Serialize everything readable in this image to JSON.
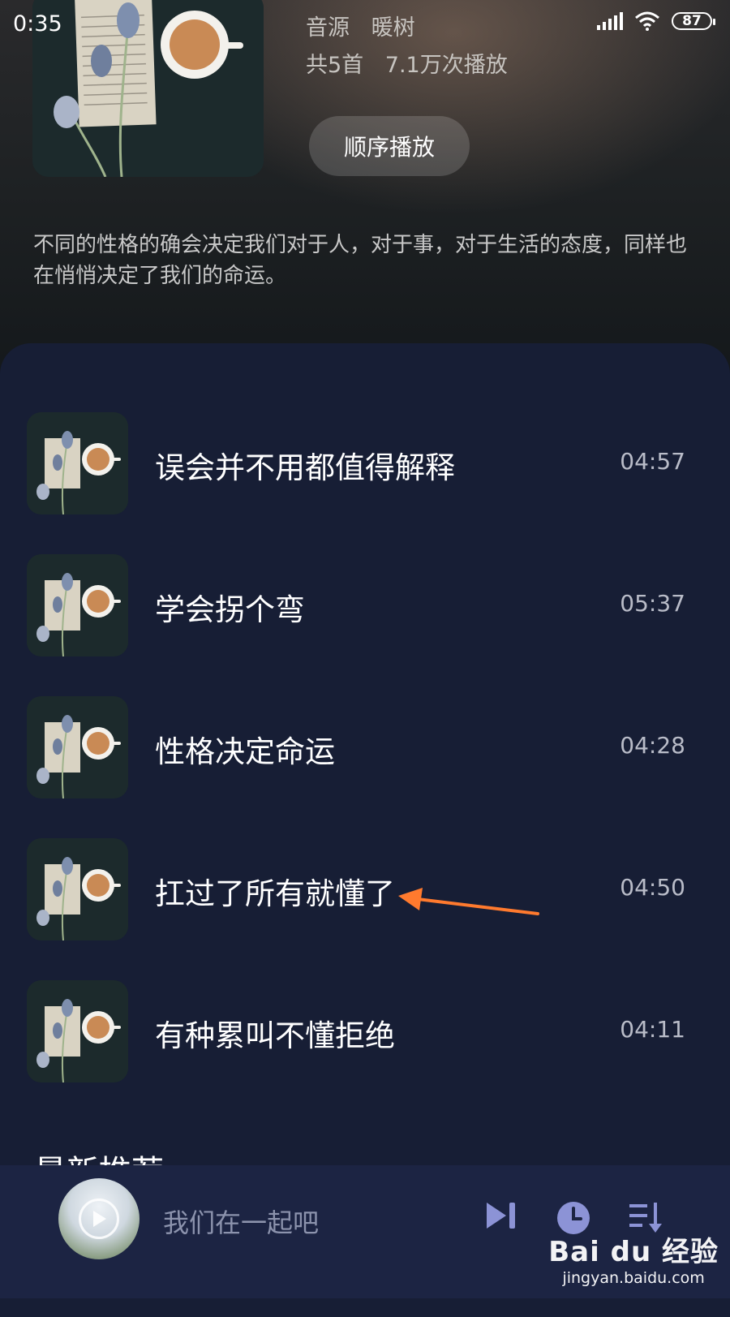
{
  "status_bar": {
    "time": "0:35",
    "battery": "87"
  },
  "album": {
    "source_label": "音源",
    "source_name": "暖树",
    "track_count": "共5首",
    "play_count": "7.1万次播放",
    "play_order_label": "顺序播放",
    "description": "不同的性格的确会决定我们对于人，对于事，对于生活的态度，同样也在悄悄决定了我们的命运。"
  },
  "tracks": [
    {
      "title": "误会并不用都值得解释",
      "duration": "04:57"
    },
    {
      "title": "学会拐个弯",
      "duration": "05:37"
    },
    {
      "title": "性格决定命运",
      "duration": "04:28"
    },
    {
      "title": "扛过了所有就懂了",
      "duration": "04:50"
    },
    {
      "title": "有种累叫不懂拒绝",
      "duration": "04:11"
    }
  ],
  "section": {
    "heading": "最新推荐"
  },
  "mini_player": {
    "title": "我们在一起吧"
  },
  "watermark": {
    "logo": "Bai du 经验",
    "url": "jingyan.baidu.com"
  },
  "colors": {
    "panel": "#171e35",
    "annotation_arrow": "#ff7a2e"
  },
  "icons": [
    "signal-icon",
    "wifi-icon",
    "battery-icon",
    "play-icon",
    "next-icon",
    "timer-icon",
    "playlist-icon"
  ]
}
